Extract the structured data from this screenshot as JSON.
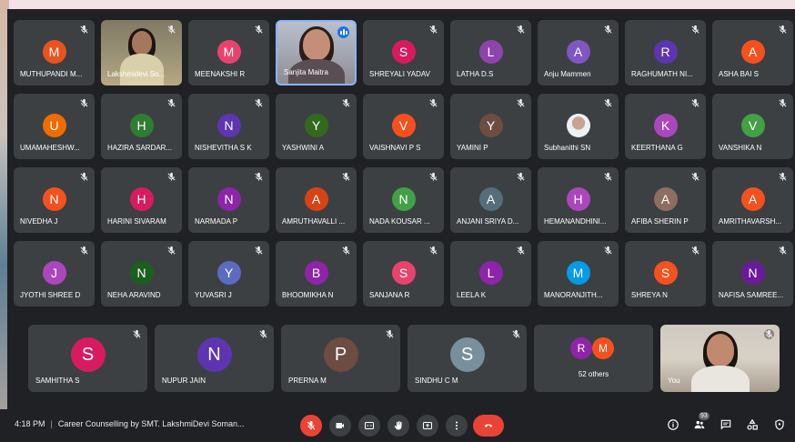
{
  "colors": {
    "background": "#202124",
    "tile": "#3c4043",
    "danger": "#ea4335",
    "speaking": "#1a73e8"
  },
  "participants": [
    {
      "name": "MUTHUPANDI M...",
      "initial": "M",
      "color": "#e8541d"
    },
    {
      "name": "Lakshmidevi So...",
      "video": true
    },
    {
      "name": "MEENAKSHI R",
      "initial": "M",
      "color": "#e8436d"
    },
    {
      "name": "Sanjita Maitra",
      "video": true,
      "speaking": true
    },
    {
      "name": "SHREYALI YADAV",
      "initial": "S",
      "color": "#d81b60"
    },
    {
      "name": "LATHA D.S",
      "initial": "L",
      "color": "#8e44ad"
    },
    {
      "name": "Anju Mammen",
      "initial": "A",
      "color": "#7e57c2"
    },
    {
      "name": "RAGHUMATH NI...",
      "initial": "R",
      "color": "#5e35b1"
    },
    {
      "name": "ASHA BAI S",
      "initial": "A",
      "color": "#f4511e"
    },
    {
      "name": "UMAMAHESHW...",
      "initial": "U",
      "color": "#ef6c00"
    },
    {
      "name": "HAZIRA SARDAR...",
      "initial": "H",
      "color": "#2e7d32"
    },
    {
      "name": "NISHEVITHA S K",
      "initial": "N",
      "color": "#5e35b1"
    },
    {
      "name": "YASHWINI A",
      "initial": "Y",
      "color": "#33691e"
    },
    {
      "name": "VAISHNAVI P S",
      "initial": "V",
      "color": "#f4511e"
    },
    {
      "name": "YAMINI P",
      "initial": "Y",
      "color": "#6d4c41"
    },
    {
      "name": "Subhanithi SN",
      "photo": true
    },
    {
      "name": "KEERTHANA G",
      "initial": "K",
      "color": "#ab47bc"
    },
    {
      "name": "VANSHIKA N",
      "initial": "V",
      "color": "#43a047"
    },
    {
      "name": "NIVEDHA J",
      "initial": "N",
      "color": "#f4511e"
    },
    {
      "name": "HARINI SIVARAM",
      "initial": "H",
      "color": "#d81b60"
    },
    {
      "name": "NARMADA P",
      "initial": "N",
      "color": "#8e24aa"
    },
    {
      "name": "AMRUTHAVALLI ...",
      "initial": "A",
      "color": "#d84315"
    },
    {
      "name": "NADA KOUSAR ...",
      "initial": "N",
      "color": "#43a047"
    },
    {
      "name": "ANJANI SRIYA D...",
      "initial": "A",
      "color": "#546e7a"
    },
    {
      "name": "HEMANANDHINI...",
      "initial": "H",
      "color": "#ab47bc"
    },
    {
      "name": "AFIBA SHERIN P",
      "initial": "A",
      "color": "#8d6e63"
    },
    {
      "name": "AMRITHAVARSH...",
      "initial": "A",
      "color": "#f4511e"
    },
    {
      "name": "JYOTHI SHREE D",
      "initial": "J",
      "color": "#ab47bc"
    },
    {
      "name": "NEHA ARAVIND",
      "initial": "N",
      "color": "#1b5e20"
    },
    {
      "name": "YUVASRI J",
      "initial": "Y",
      "color": "#5c6bc0"
    },
    {
      "name": "BHOOMIKHA N",
      "initial": "B",
      "color": "#8e24aa"
    },
    {
      "name": "SANJANA R",
      "initial": "S",
      "color": "#e8436d"
    },
    {
      "name": "LEELA K",
      "initial": "L",
      "color": "#8e24aa"
    },
    {
      "name": "MANORANJITH...",
      "initial": "M",
      "color": "#039be5"
    },
    {
      "name": "SHREYA N",
      "initial": "S",
      "color": "#f4511e"
    },
    {
      "name": "NAFISA SAMREE...",
      "initial": "N",
      "color": "#6a1b9a"
    }
  ],
  "big_participants": [
    {
      "name": "SAMHITHA S",
      "initial": "S",
      "color": "#d81b60"
    },
    {
      "name": "NUPUR JAIN",
      "initial": "N",
      "color": "#5e35b1"
    },
    {
      "name": "PRERNA M",
      "initial": "P",
      "color": "#6d4c41"
    },
    {
      "name": "SINDHU C M",
      "initial": "S",
      "color": "#78909c"
    }
  ],
  "others": {
    "label": "52 others",
    "avatars": [
      {
        "initial": "R",
        "color": "#8e24aa"
      },
      {
        "initial": "M",
        "color": "#f4511e"
      }
    ]
  },
  "self_tile": {
    "name": "You"
  },
  "footer": {
    "time": "4:18 PM",
    "separator": "|",
    "meeting_title": "Career Counselling by SMT. LakshmiDevi Soman..."
  },
  "controls": [
    {
      "name": "mic-off",
      "icon": "mic-off-icon"
    },
    {
      "name": "camera",
      "icon": "camera-icon"
    },
    {
      "name": "captions",
      "icon": "captions-icon"
    },
    {
      "name": "raise-hand",
      "icon": "hand-icon"
    },
    {
      "name": "present",
      "icon": "present-icon"
    },
    {
      "name": "more",
      "icon": "more-vert-icon"
    },
    {
      "name": "leave-call",
      "icon": "call-end-icon"
    }
  ],
  "side_controls": {
    "participants_count": "93"
  }
}
